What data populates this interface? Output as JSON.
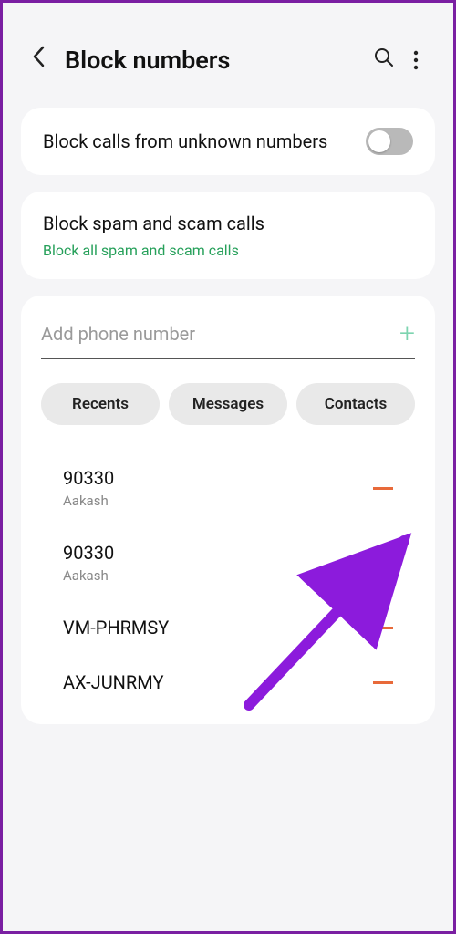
{
  "header": {
    "title": "Block numbers"
  },
  "settings": {
    "unknown": {
      "label": "Block calls from unknown numbers"
    },
    "spam": {
      "title": "Block spam and scam calls",
      "subtitle": "Block all spam and scam calls"
    }
  },
  "input": {
    "placeholder": "Add phone number"
  },
  "tabs": {
    "recents": "Recents",
    "messages": "Messages",
    "contacts": "Contacts"
  },
  "blocked": [
    {
      "number": "90330",
      "name": "Aakash"
    },
    {
      "number": "90330",
      "name": "Aakash"
    },
    {
      "number": "VM-PHRMSY",
      "name": ""
    },
    {
      "number": "AX-JUNRMY",
      "name": ""
    }
  ]
}
